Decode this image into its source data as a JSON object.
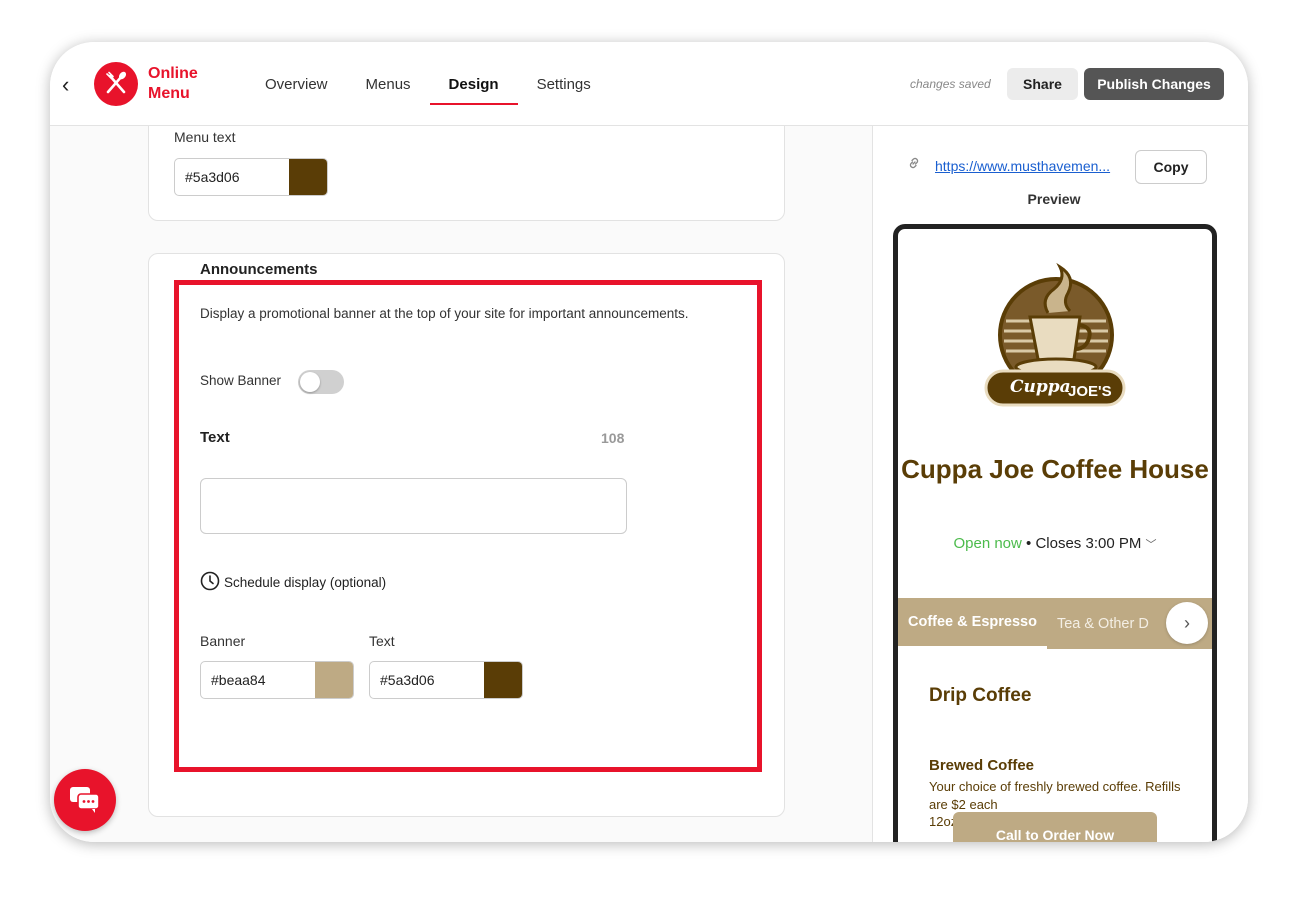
{
  "header": {
    "back_glyph": "‹",
    "brand_line1": "Online",
    "brand_line2": "Menu",
    "tabs": [
      {
        "label": "Overview"
      },
      {
        "label": "Menus"
      },
      {
        "label": "Design",
        "active": true
      },
      {
        "label": "Settings"
      }
    ],
    "status": "changes saved",
    "share_label": "Share",
    "publish_label": "Publish Changes"
  },
  "menu_text": {
    "label": "Menu text",
    "value": "#5a3d06",
    "swatch": "#5a3d06"
  },
  "announcements": {
    "title": "Announcements",
    "description": "Display a promotional banner at the top of your site for important announcements.",
    "show_banner_label": "Show Banner",
    "show_banner_on": false,
    "text_label": "Text",
    "char_count": "108",
    "text_value": "",
    "schedule_label": "Schedule display (optional)",
    "banner_label": "Banner",
    "banner_value": "#beaa84",
    "banner_swatch": "#beaa84",
    "text_color_label": "Text",
    "text_color_value": "#5a3d06",
    "text_color_swatch": "#5a3d06"
  },
  "preview": {
    "url": "https://www.musthavemen...",
    "copy_label": "Copy",
    "label": "Preview",
    "logo_word1": "Cuppa",
    "logo_word2": "JOE'S",
    "business_name": "Cuppa Joe Coffee House",
    "open_status": "Open now",
    "closes": "Closes 3:00 PM",
    "categories": [
      "Coffee & Espresso",
      "Tea & Other D"
    ],
    "section_title": "Drip Coffee",
    "item_name": "Brewed Coffee",
    "item_description": "Your choice of freshly brewed coffee. Refills are $2 each",
    "item_size": "12oz",
    "cta_label": "Call to Order Now"
  },
  "colors": {
    "accent": "#e8132b",
    "brand_brown": "#5a3d06",
    "banner_tan": "#beaa84",
    "open_green": "#4cbb4c"
  }
}
